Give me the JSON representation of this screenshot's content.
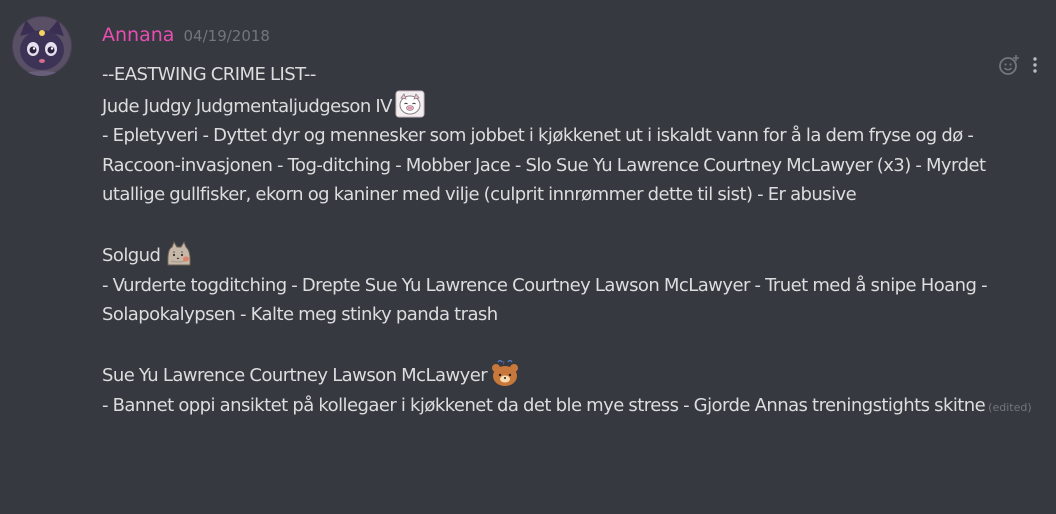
{
  "message": {
    "author": "Annana",
    "timestamp": "04/19/2018",
    "author_color": "#e84eb1",
    "avatar": "cat-avatar-icon",
    "lines": {
      "title": "--EASTWING CRIME LIST--",
      "jude_name": "Jude Judgy Judgmentaljudgeson IV",
      "jude_crimes": "- Epletyveri  - Dyttet dyr og mennesker som jobbet i kjøkkenet ut i iskaldt vann for å la dem fryse og dø - Raccoon-invasjonen - Tog-ditching - Mobber Jace - Slo Sue Yu Lawrence Courtney McLawyer (x3) - Myrdet utallige gullfisker, ekorn og kaniner med vilje (culprit innrømmer dette til sist) - Er abusive",
      "solgud_name": "Solgud",
      "solgud_crimes_1": "- Vurderte togditching - Drepte Sue Yu Lawrence Courtney Lawson McLawyer - Truet med å snipe Hoang -",
      "solgud_crimes_2": "Solapokalypsen - Kalte meg stinky panda trash",
      "sue_name": "Sue Yu Lawrence Courtney Lawson McLawyer",
      "sue_crimes": "- Bannet oppi ansiktet på kollegaer i kjøkkenet da det ble mye stress - Gjorde Annas treningstights skitne"
    },
    "edited_label": "(edited)",
    "emojis": [
      "pig-face-emoji",
      "pusheen-cat-emoji",
      "rilakkuma-bear-emoji"
    ]
  },
  "actions": [
    "add-reaction-icon",
    "more-options-icon"
  ],
  "colors": {
    "background": "#36393f",
    "text": "#dcddde",
    "muted": "#72767d"
  }
}
